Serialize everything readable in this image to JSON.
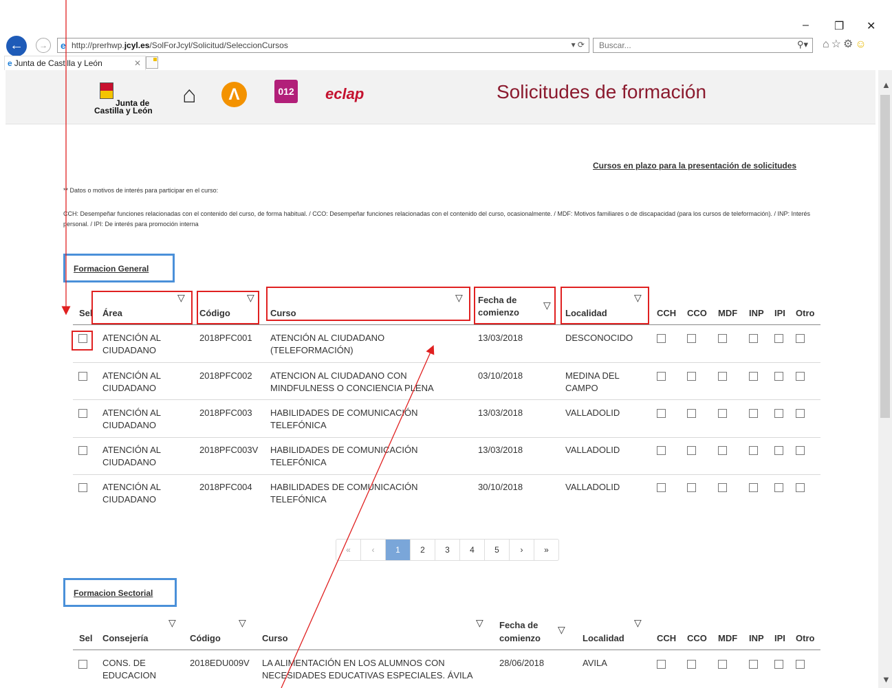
{
  "browser": {
    "url": "http://prerhwp.jcyl.es/SolForJcyl/Solicitud/SeleccionCursos",
    "url_host_prefix": "http://prerhwp.",
    "url_host_bold": "jcyl.es",
    "url_path": "/SolForJcyl/Solicitud/SeleccionCursos",
    "search_placeholder": "Buscar...",
    "tab_title": "Junta de Castilla y León",
    "window_min": "–",
    "window_restore": "❐",
    "window_close": "✕"
  },
  "header": {
    "logo_line1": "Junta de",
    "logo_line2": "Castilla y León",
    "logo_012": "012",
    "logo_eclap": "eclap",
    "title": "Solicitudes de formación"
  },
  "page": {
    "top_link": "Cursos en plazo para la presentación de solicitudes",
    "note_title": "** Datos o motivos de interés para participar en el curso:",
    "note_body": "CCH: Desempeñar funciones relacionadas con el contenido del curso, de forma habitual. / CCO: Desempeñar funciones relacionadas con el contenido del curso, ocasionalmente. / MDF: Motivos familiares o de discapacidad (para los cursos de teleformación). / INP: Interés personal. / IPI: De interés para promoción interna"
  },
  "general": {
    "title": "Formacion General",
    "headers": {
      "sel": "Sel",
      "area": "Área",
      "codigo": "Código",
      "curso": "Curso",
      "fecha1": "Fecha de",
      "fecha2": "comienzo",
      "localidad": "Localidad",
      "cch": "CCH",
      "cco": "CCO",
      "mdf": "MDF",
      "inp": "INP",
      "ipi": "IPI",
      "otro": "Otro"
    },
    "rows": [
      {
        "area1": "ATENCIÓN AL",
        "area2": "CIUDADANO",
        "codigo": "2018PFC001",
        "curso1": "ATENCIÓN AL CIUDADANO",
        "curso2": "(TELEFORMACIÓN)",
        "fecha": "13/03/2018",
        "loc1": "DESCONOCIDO",
        "loc2": ""
      },
      {
        "area1": "ATENCIÓN AL",
        "area2": "CIUDADANO",
        "codigo": "2018PFC002",
        "curso1": "ATENCION AL CIUDADANO CON",
        "curso2": "MINDFULNESS O CONCIENCIA PLENA",
        "fecha": "03/10/2018",
        "loc1": "MEDINA DEL",
        "loc2": "CAMPO"
      },
      {
        "area1": "ATENCIÓN AL",
        "area2": "CIUDADANO",
        "codigo": "2018PFC003",
        "curso1": "HABILIDADES DE COMUNICACIÓN",
        "curso2": "TELEFÓNICA",
        "fecha": "13/03/2018",
        "loc1": "VALLADOLID",
        "loc2": ""
      },
      {
        "area1": "ATENCIÓN AL",
        "area2": "CIUDADANO",
        "codigo": "2018PFC003V",
        "curso1": "HABILIDADES DE COMUNICACIÓN",
        "curso2": "TELEFÓNICA",
        "fecha": "13/03/2018",
        "loc1": "VALLADOLID",
        "loc2": ""
      },
      {
        "area1": "ATENCIÓN AL",
        "area2": "CIUDADANO",
        "codigo": "2018PFC004",
        "curso1": "HABILIDADES DE COMUNICACIÓN",
        "curso2": "TELEFÓNICA",
        "fecha": "30/10/2018",
        "loc1": "VALLADOLID",
        "loc2": ""
      }
    ],
    "pagination": {
      "first": "«",
      "prev": "‹",
      "pages": [
        "1",
        "2",
        "3",
        "4",
        "5"
      ],
      "next": "›",
      "last": "»",
      "current": "1"
    }
  },
  "sectorial": {
    "title": "Formacion Sectorial",
    "headers": {
      "sel": "Sel",
      "consejeria": "Consejería",
      "codigo": "Código",
      "curso": "Curso",
      "fecha1": "Fecha de",
      "fecha2": "comienzo",
      "localidad": "Localidad",
      "cch": "CCH",
      "cco": "CCO",
      "mdf": "MDF",
      "inp": "INP",
      "ipi": "IPI",
      "otro": "Otro"
    },
    "rows": [
      {
        "cons1": "CONS. DE",
        "cons2": "EDUCACION",
        "codigo": "2018EDU009V",
        "curso1": "LA ALIMENTACIÓN EN LOS ALUMNOS CON",
        "curso2": "NECESIDADES EDUCATIVAS ESPECIALES. ÁVILA",
        "fecha": "28/06/2018",
        "loc1": "AVILA",
        "loc2": ""
      }
    ]
  },
  "colors": {
    "annotation_red": "#e02020",
    "annotation_blue": "#4a90d9",
    "title_color": "#8b1a2e",
    "page_active": "#7aa6d9"
  }
}
